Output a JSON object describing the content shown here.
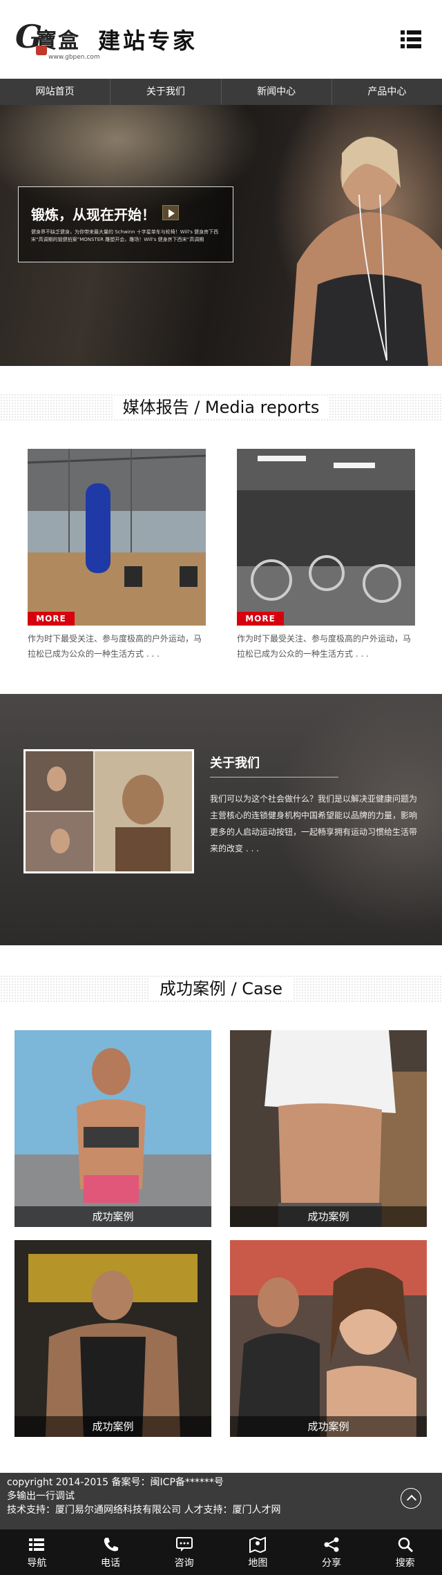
{
  "header": {
    "logo_letter": "G",
    "logo_mark": "寶盒",
    "logo_text": "建站专家",
    "logo_url": "www.gbpen.com"
  },
  "nav": [
    {
      "label": "网站首页"
    },
    {
      "label": "关于我们"
    },
    {
      "label": "新闻中心"
    },
    {
      "label": "产品中心"
    }
  ],
  "hero": {
    "title": "锻炼，从现在开始！",
    "desc": "健身界不缺乏健身，为你带来最大量的 Schwinn 十字星单车与轮椅！Will's 健身房下西宋“高调期的锻健拍案”MONSTER 雕塑开会，雕场！Will's 健身房下西宋“高调期"
  },
  "media": {
    "title": "媒体报告 / Media reports",
    "cards": [
      {
        "more": "MORE",
        "text": "作为时下最受关注、参与度极高的户外运动，马拉松已成为公众的一种生活方式 . . ."
      },
      {
        "more": "MORE",
        "text": "作为时下最受关注、参与度极高的户外运动，马拉松已成为公众的一种生活方式 . . ."
      }
    ]
  },
  "about": {
    "title": "关于我们",
    "text": "我们可以为这个社会做什么？我们是以解决亚健康问题为主营核心的连锁健身机构中国希望能以品牌的力量，影响更多的人启动运动按钮，一起畅享拥有运动习惯给生活带来的改变 . . ."
  },
  "cases": {
    "title": "成功案例 / Case",
    "items": [
      {
        "caption": "成功案例"
      },
      {
        "caption": "成功案例"
      },
      {
        "caption": "成功案例"
      },
      {
        "caption": "成功案例"
      }
    ]
  },
  "footer": {
    "line1": "copyright 2014-2015 备案号：闽ICP备******号",
    "line2": "多输出一行调试",
    "line3": "技术支持：厦门易尔通网络科技有限公司 人才支持：厦门人才网"
  },
  "tabbar": [
    {
      "label": "导航",
      "icon": "list-icon"
    },
    {
      "label": "电话",
      "icon": "phone-icon"
    },
    {
      "label": "咨询",
      "icon": "chat-icon"
    },
    {
      "label": "地图",
      "icon": "map-icon"
    },
    {
      "label": "分享",
      "icon": "share-icon"
    },
    {
      "label": "搜索",
      "icon": "search-icon"
    }
  ],
  "colors": {
    "nav_bg": "#3b3b3b",
    "more_red": "#d7000f",
    "tabbar_bg": "#141414"
  }
}
